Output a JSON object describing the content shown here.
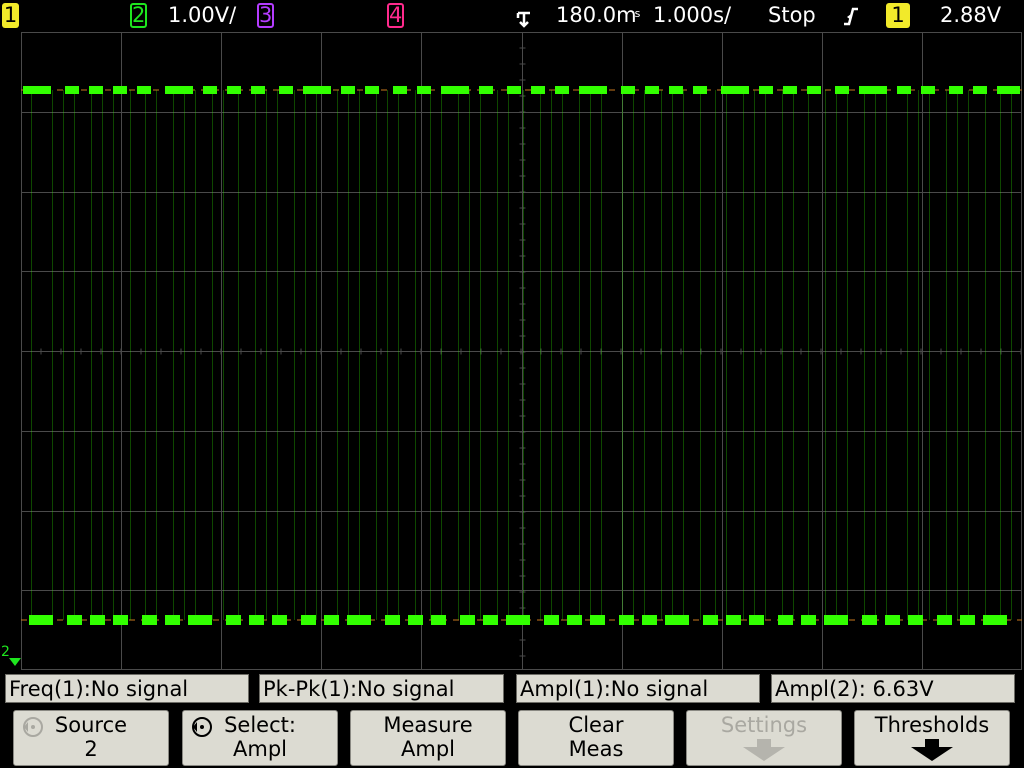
{
  "topbar": {
    "ch1": "1",
    "ch2": "2",
    "ch2_scale": "1.00V/",
    "ch3": "3",
    "ch4": "4",
    "trigger_delay": "180.0m",
    "trigger_delay_suffix": "s",
    "timebase": "1.000s/",
    "run_state": "Stop",
    "trigger_slope": "rising",
    "trigger_source": "1",
    "trigger_level": "2.88V"
  },
  "screen": {
    "ground_marker_label": "2"
  },
  "measurements": [
    {
      "label": "Freq(1):No signal"
    },
    {
      "label": "Pk-Pk(1):No signal"
    },
    {
      "label": "Ampl(1):No signal"
    },
    {
      "label": "Ampl(2): 6.63V"
    }
  ],
  "softkeys": {
    "source": {
      "line1": "Source",
      "line2": "2"
    },
    "select": {
      "line1": "Select:",
      "line2": "Ampl"
    },
    "measure": {
      "line1": "Measure",
      "line2": "Ampl"
    },
    "clear": {
      "line1": "Clear",
      "line2": "Meas"
    },
    "settings": {
      "line1": "Settings"
    },
    "thresholds": {
      "line1": "Thresholds"
    }
  },
  "colors": {
    "ch1": "#f2ea2a",
    "ch2": "#1ee61e",
    "ch3": "#b43cff",
    "ch4": "#ff2a8c",
    "trace": "#32ff00",
    "grid": "#4a4a4a",
    "softkey_bg": "#dcdbd2",
    "trigger_marker": "#ff8c00"
  }
}
